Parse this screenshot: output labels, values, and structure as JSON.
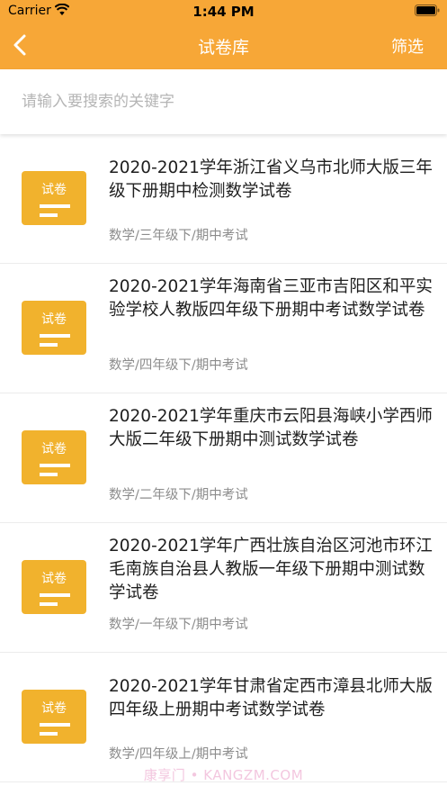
{
  "status_bar": {
    "carrier": "Carrier",
    "time": "1:44 PM"
  },
  "nav": {
    "title": "试卷库",
    "filter_label": "筛选"
  },
  "search": {
    "placeholder": "请输入要搜索的关键字"
  },
  "theme": {
    "header_color": "#f7a737",
    "icon_color": "#f1b22d"
  },
  "papers": [
    {
      "icon_label": "试卷",
      "title": "2020-2021学年浙江省义乌市北师大版三年级下册期中检测数学试卷",
      "tag": "数学/三年级下/期中考试"
    },
    {
      "icon_label": "试卷",
      "title": "2020-2021学年海南省三亚市吉阳区和平实验学校人教版四年级下册期中考试数学试卷",
      "tag": "数学/四年级下/期中考试"
    },
    {
      "icon_label": "试卷",
      "title": "2020-2021学年重庆市云阳县海峡小学西师大版二年级下册期中测试数学试卷",
      "tag": "数学/二年级下/期中考试"
    },
    {
      "icon_label": "试卷",
      "title": "2020-2021学年广西壮族自治区河池市环江毛南族自治县人教版一年级下册期中测试数学试卷",
      "tag": "数学/一年级下/期中考试"
    },
    {
      "icon_label": "试卷",
      "title": "2020-2021学年甘肃省定西市漳县北师大版四年级上册期中考试数学试卷",
      "tag": "数学/四年级上/期中考试"
    }
  ],
  "watermark": "康享门 • KANGZM.COM"
}
